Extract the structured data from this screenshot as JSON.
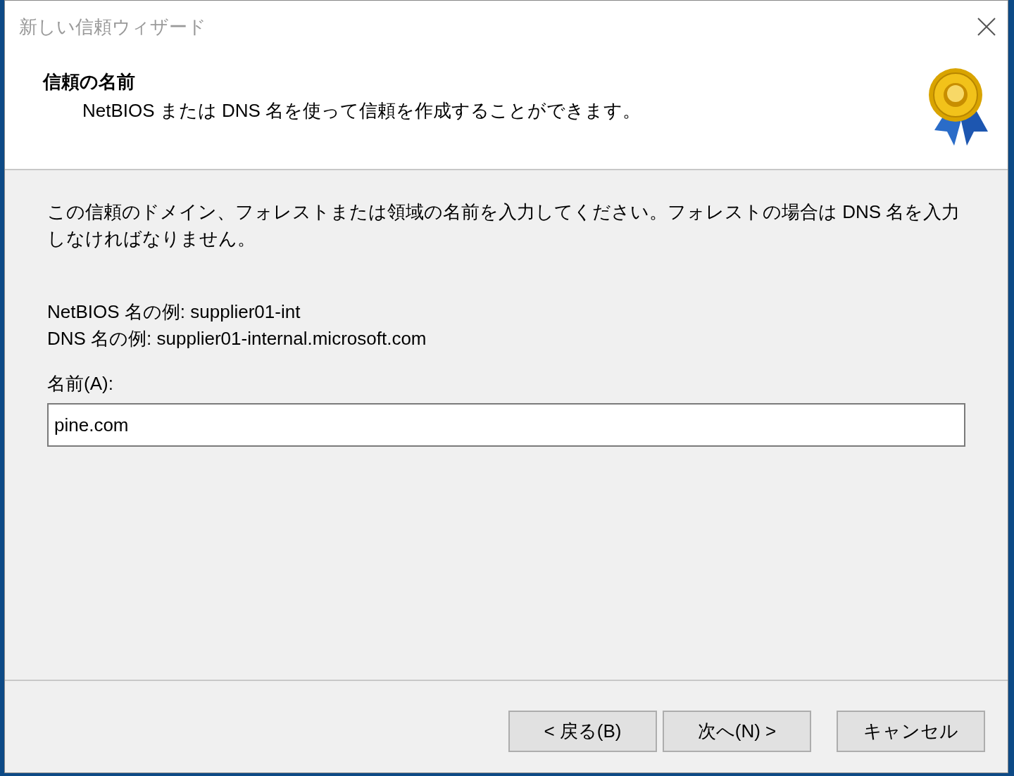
{
  "window": {
    "title": "新しい信頼ウィザード"
  },
  "header": {
    "title": "信頼の名前",
    "subtitle": "NetBIOS または DNS 名を使って信頼を作成することができます。"
  },
  "instructions": "この信頼のドメイン、フォレストまたは領域の名前を入力してください。フォレストの場合は DNS 名を入力しなければなりません。",
  "examples": [
    "NetBIOS 名の例: supplier01-int",
    "DNS 名の例: supplier01-internal.microsoft.com"
  ],
  "name_field": {
    "label": "名前(A):",
    "value": "pine.com"
  },
  "buttons": [
    {
      "label": "< 戻る(B)",
      "kind": "back"
    },
    {
      "label": "次へ(N) >",
      "kind": "next"
    },
    {
      "label": "キャンセル",
      "kind": "cancel"
    }
  ]
}
